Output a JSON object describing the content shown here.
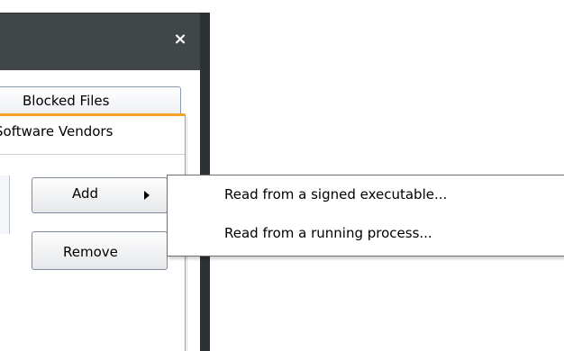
{
  "dialog": {
    "close_glyph": "×",
    "tabs": {
      "blocked_files": "Blocked Files",
      "software_vendors": "Software Vendors"
    },
    "buttons": {
      "add": "Add",
      "remove": "Remove"
    },
    "colors": {
      "titlebar": "#414649",
      "tab_accent": "#f6a02a"
    }
  },
  "add_menu": {
    "items": [
      {
        "label": "Read from a signed executable..."
      },
      {
        "label": "Read from a running process..."
      }
    ]
  },
  "icons": {
    "close": "close-icon",
    "submenu_arrow": "submenu-arrow-icon"
  }
}
